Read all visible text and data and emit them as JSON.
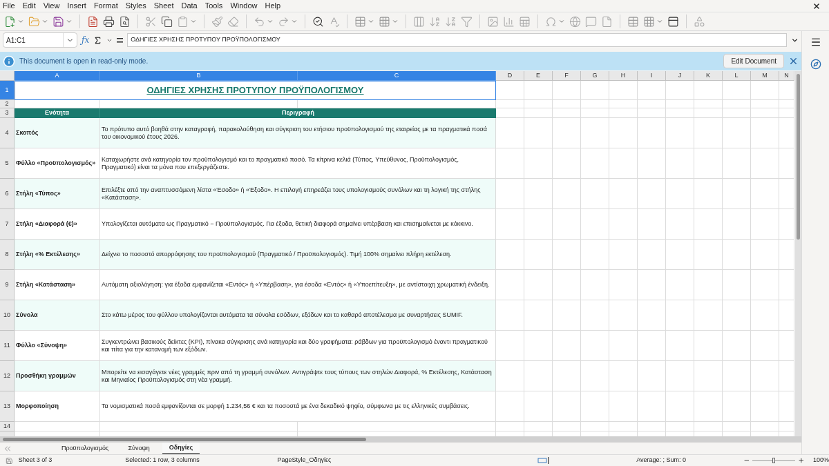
{
  "menu": [
    "File",
    "Edit",
    "View",
    "Insert",
    "Format",
    "Styles",
    "Sheet",
    "Data",
    "Tools",
    "Window",
    "Help"
  ],
  "formula_bar": {
    "name_box": "A1:C1",
    "function_wizard": "ƒx",
    "content": "ΟΔΗΓΙΕΣ ΧΡΗΣΗΣ ΠΡΟΤΥΠΟΥ ΠΡΟΫΠΟΛΟΓΙΣΜΟΥ"
  },
  "infobar": {
    "message": "This document is open in read-only mode.",
    "button": "Edit Document"
  },
  "columns": [
    {
      "label": "A",
      "selected": true
    },
    {
      "label": "B",
      "selected": true
    },
    {
      "label": "C",
      "selected": true
    },
    {
      "label": "D",
      "selected": false
    },
    {
      "label": "E",
      "selected": false
    },
    {
      "label": "F",
      "selected": false
    },
    {
      "label": "G",
      "selected": false
    },
    {
      "label": "H",
      "selected": false
    },
    {
      "label": "I",
      "selected": false
    },
    {
      "label": "J",
      "selected": false
    },
    {
      "label": "K",
      "selected": false
    },
    {
      "label": "L",
      "selected": false
    },
    {
      "label": "M",
      "selected": false
    },
    {
      "label": "N",
      "selected": false
    }
  ],
  "title_row": {
    "number": "1",
    "selected": true,
    "text": "ΟΔΗΓΙΕΣ ΧΡΗΣΗΣ ΠΡΟΤΥΠΟΥ ΠΡΟΫΠΟΛΟΓΙΣΜΟΥ"
  },
  "empty_row": "2",
  "header_row": {
    "number": "3",
    "section": "Ενότητα",
    "description": "Περιγραφή"
  },
  "entries": [
    {
      "number": "4",
      "section": "Σκοπός",
      "description": "Το πρότυπο αυτό βοηθά στην καταγραφή, παρακολούθηση και σύγκριση του ετήσιου προϋπολογισμού της εταιρείας με τα πραγματικά ποσά του οικονομικού έτους 2026."
    },
    {
      "number": "5",
      "section": "Φύλλο «Προϋπολογισμός»",
      "description": "Καταχωρήστε ανά κατηγορία τον προϋπολογισμό και το πραγματικό ποσό. Τα κίτρινα κελιά (Τύπος, Υπεύθυνος, Προϋπολογισμός, Πραγματικό) είναι τα μόνα που επεξεργάζεστε."
    },
    {
      "number": "6",
      "section": "Στήλη «Τύπος»",
      "description": "Επιλέξτε από την αναπτυσσόμενη λίστα «Έσοδο» ή «Έξοδο». Η επιλογή επηρεάζει τους υπολογισμούς συνόλων και τη λογική της στήλης «Κατάσταση»."
    },
    {
      "number": "7",
      "section": "Στήλη «Διαφορά (€)»",
      "description": "Υπολογίζεται αυτόματα ως Πραγματικό − Προϋπολογισμός. Για έξοδα, θετική διαφορά σημαίνει υπέρβαση και επισημαίνεται με κόκκινο."
    },
    {
      "number": "8",
      "section": "Στήλη «% Εκτέλεσης»",
      "description": "Δείχνει το ποσοστό απορρόφησης του προϋπολογισμού (Πραγματικό / Προϋπολογισμός). Τιμή 100% σημαίνει πλήρη εκτέλεση."
    },
    {
      "number": "9",
      "section": "Στήλη «Κατάσταση»",
      "description": "Αυτόματη αξιολόγηση: για έξοδα εμφανίζεται «Εντός» ή «Υπέρβαση», για έσοδα «Εντός» ή «Υποεπίτευξη», με αντίστοιχη χρωματική ένδειξη."
    },
    {
      "number": "10",
      "section": "Σύνολα",
      "description": "Στο κάτω μέρος του φύλλου υπολογίζονται αυτόματα τα σύνολα εσόδων, εξόδων και το καθαρό αποτέλεσμα με συναρτήσεις SUMIF."
    },
    {
      "number": "11",
      "section": "Φύλλο «Σύνοψη»",
      "description": "Συγκεντρώνει βασικούς δείκτες (KPI), πίνακα σύγκρισης ανά κατηγορία και δύο γραφήματα: ράβδων για προϋπολογισμό έναντι πραγματικού και πίτα για την κατανομή των εξόδων."
    },
    {
      "number": "12",
      "section": "Προσθήκη γραμμών",
      "description": "Μπορείτε να εισαγάγετε νέες γραμμές πριν από τη γραμμή συνόλων. Αντιγράψτε τους τύπους των στηλών Διαφορά, % Εκτέλεσης, Κατάσταση και Μηνιαίος Προϋπολογισμός στη νέα γραμμή."
    },
    {
      "number": "13",
      "section": "Μορφοποίηση",
      "description": "Τα νομισματικά ποσά εμφανίζονται σε μορφή 1.234,56 € και τα ποσοστά με ένα δεκαδικό ψηφίο, σύμφωνα με τις ελληνικές συμβάσεις."
    }
  ],
  "trailing_rows": [
    "14"
  ],
  "sheet_tabs": [
    {
      "label": "Προϋπολογισμός",
      "selected": false
    },
    {
      "label": "Σύνοψη",
      "selected": false
    },
    {
      "label": "Οδηγίες",
      "selected": true
    }
  ],
  "status_bar": {
    "sheet": "Sheet 3 of 3",
    "selection": "Selected: 1 row, 3 columns",
    "page_style": "PageStyle_Οδηγίες",
    "sum": "Average: ; Sum: 0",
    "zoom": "100%",
    "zoom_level": {
      "level": 0.5
    }
  }
}
